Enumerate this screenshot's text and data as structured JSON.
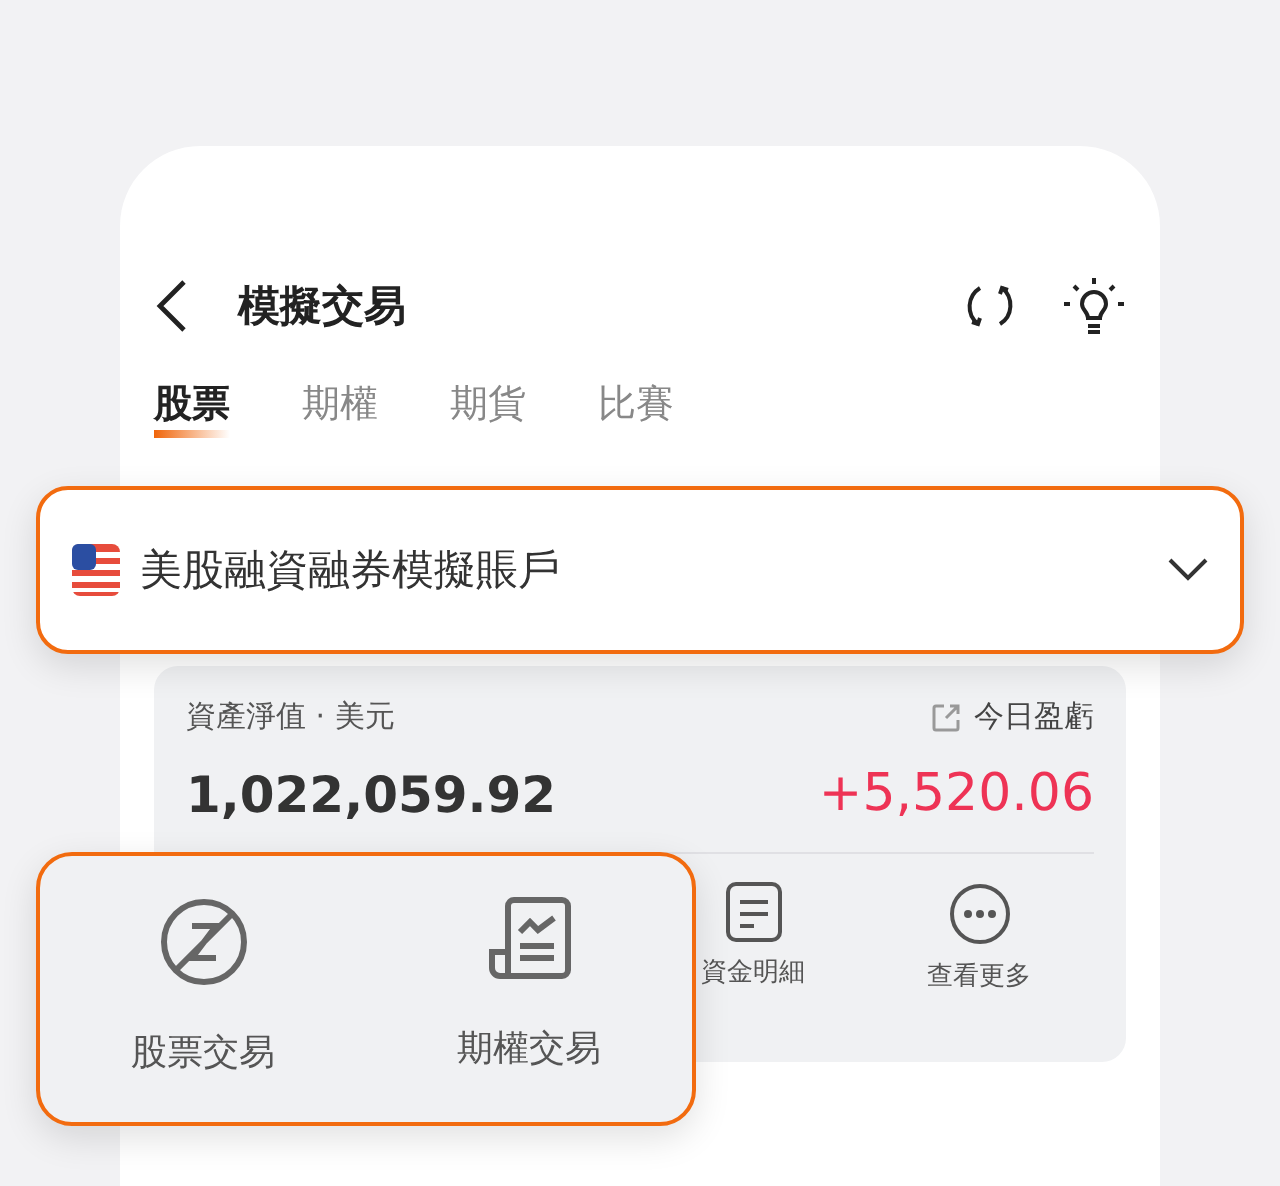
{
  "header": {
    "title": "模擬交易"
  },
  "tabs": [
    {
      "label": "股票",
      "selected": true
    },
    {
      "label": "期權",
      "selected": false
    },
    {
      "label": "期貨",
      "selected": false
    },
    {
      "label": "比賽",
      "selected": false
    }
  ],
  "account_select": {
    "value": "美股融資融券模擬賬戶"
  },
  "asset_card": {
    "label": "資產淨值 · 美元",
    "value": "1,022,059.92",
    "pnl_label": "今日盈虧",
    "pnl_value": "+5,520.06",
    "actions": [
      {
        "label": "資金明細"
      },
      {
        "label": "查看更多"
      }
    ]
  },
  "trade_actions": [
    {
      "label": "股票交易"
    },
    {
      "label": "期權交易"
    }
  ]
}
